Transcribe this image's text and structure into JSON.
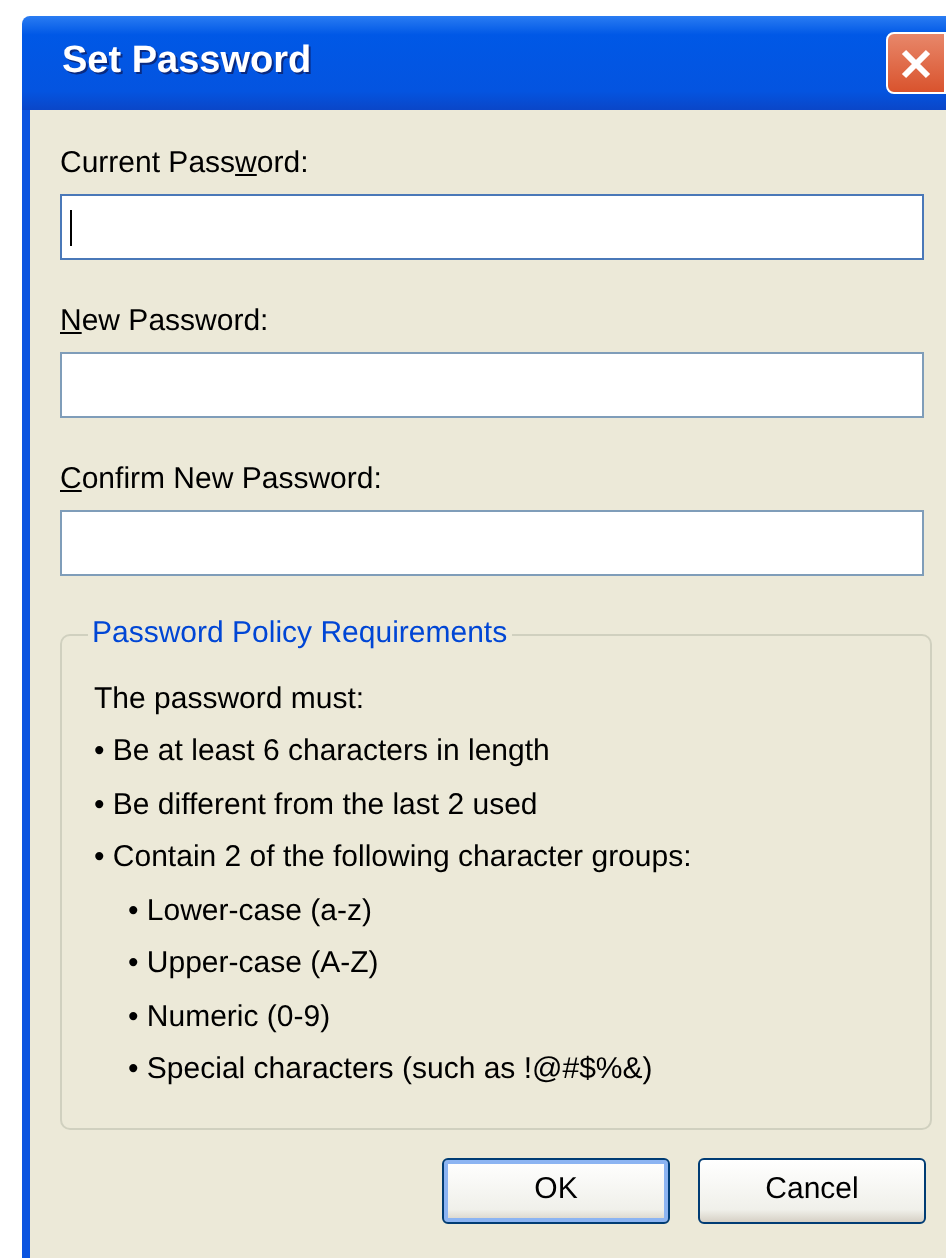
{
  "window": {
    "title": "Set Password"
  },
  "fields": [
    {
      "label": {
        "before": "Current Pass",
        "key": "w",
        "after": "ord:"
      },
      "focused": true
    },
    {
      "label": {
        "key": "N",
        "after": "ew Password:"
      },
      "focused": false
    },
    {
      "label": {
        "key": "C",
        "after": "onfirm New Password:"
      },
      "focused": false
    }
  ],
  "policy": {
    "title": "Password Policy Requirements",
    "intro": "The password must:",
    "rules": [
      {
        "text": "• Be at least 6 characters in length"
      },
      {
        "text": "• Be different from the last 2 used"
      },
      {
        "text": "• Contain 2 of the following character groups:",
        "children": [
          {
            "text": "• Lower-case (a-z)"
          },
          {
            "text": "• Upper-case (A-Z)"
          },
          {
            "text": "• Numeric (0-9)"
          },
          {
            "text": "• Special characters (such as !@#$%&)"
          }
        ]
      }
    ]
  },
  "buttons": [
    {
      "label": "OK",
      "default": true
    },
    {
      "label": "Cancel",
      "default": false
    }
  ]
}
